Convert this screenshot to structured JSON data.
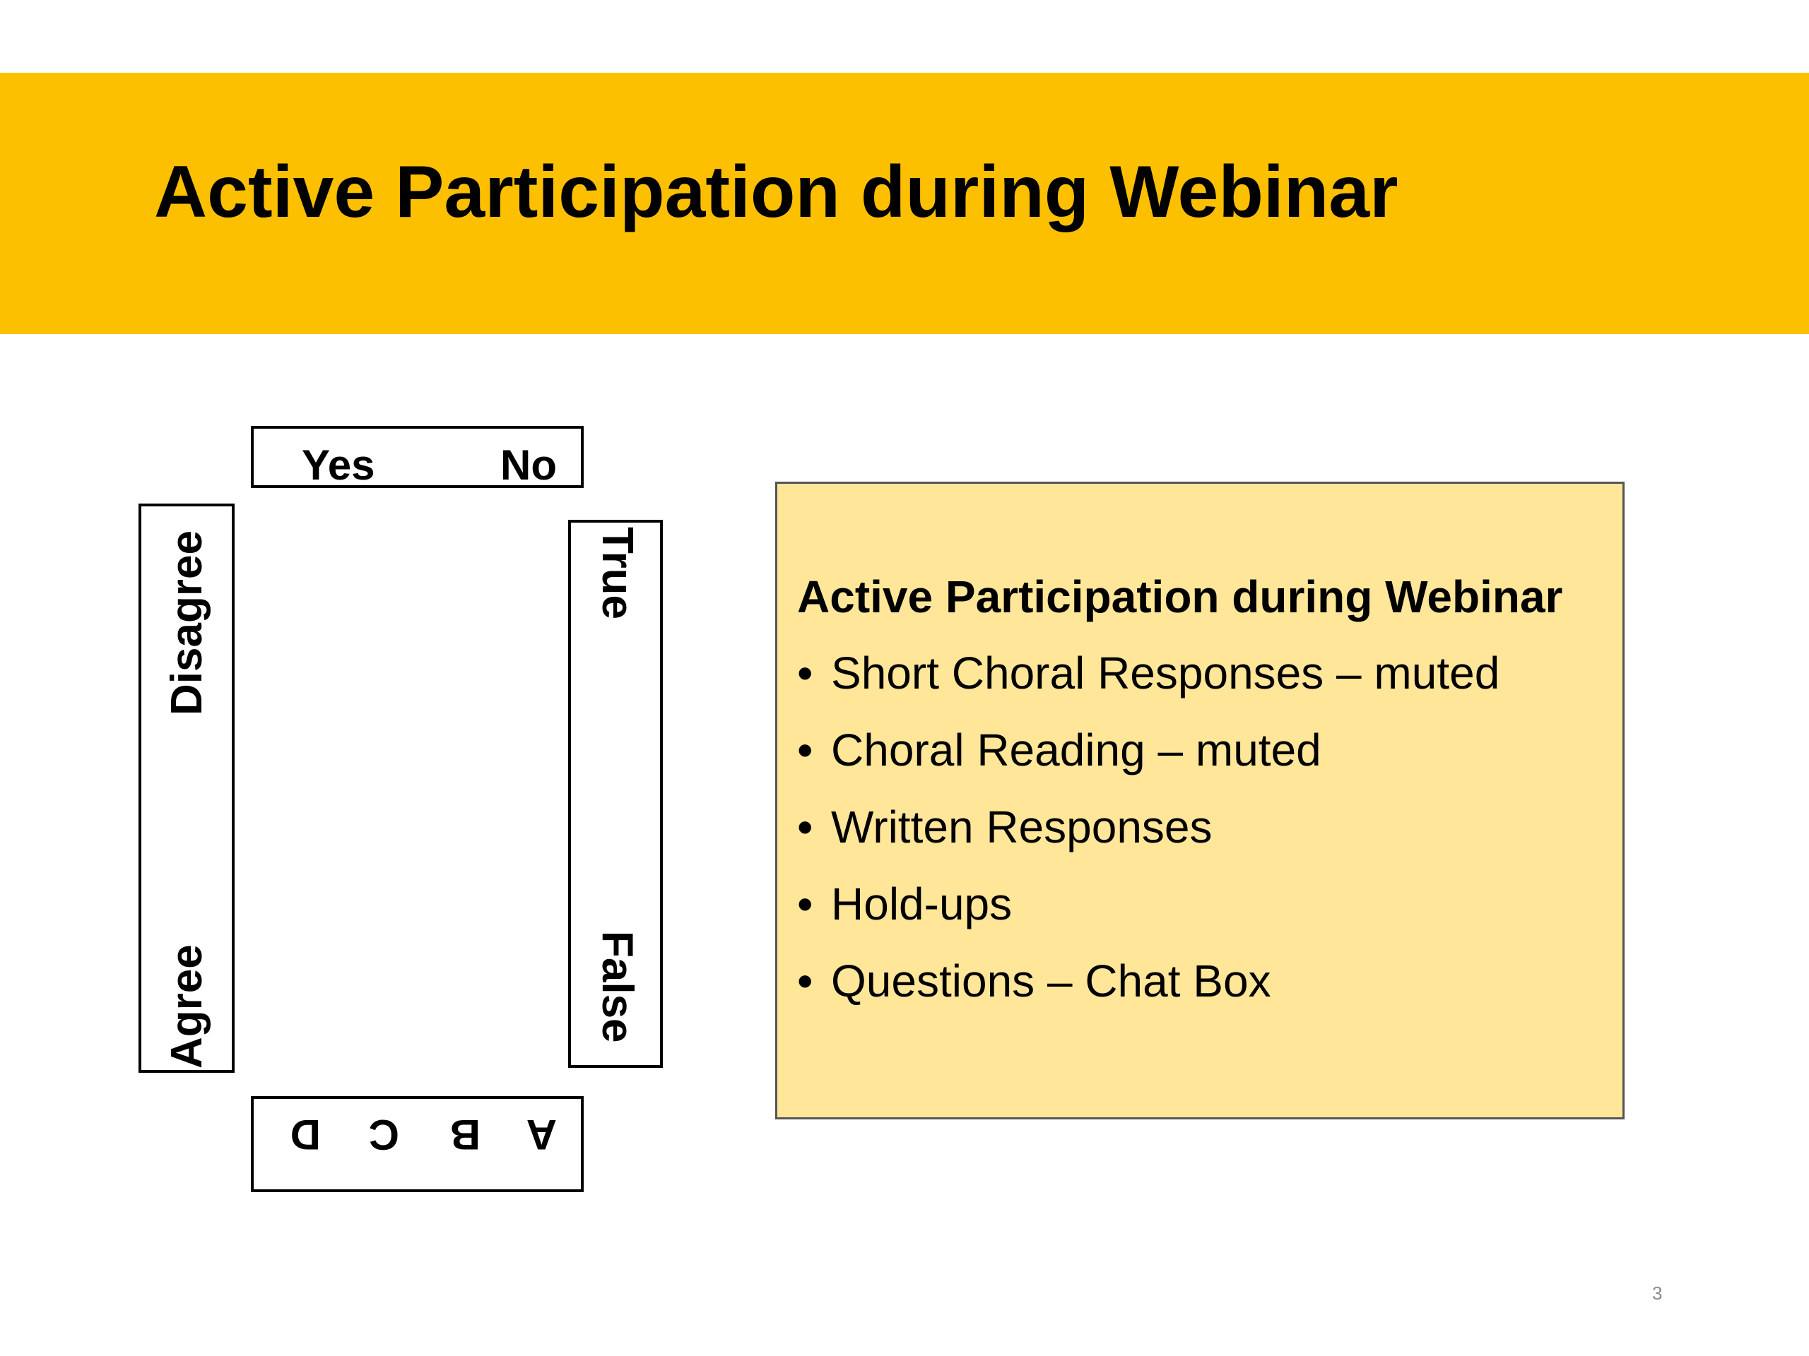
{
  "slide": {
    "title": "Active Participation during Webinar",
    "page_number": "3",
    "colors": {
      "title_band": "#FDC000",
      "info_box": "#FFE699"
    }
  },
  "cards": {
    "yes_no": {
      "left": "Yes",
      "right": "No"
    },
    "agree_disagree": {
      "first": "Agree",
      "second": "Disagree"
    },
    "true_false": {
      "first": "True",
      "second": "False"
    },
    "abcd": [
      "A",
      "B",
      "C",
      "D"
    ]
  },
  "info_box": {
    "heading": "Active Participation during Webinar",
    "bullet_glyph": "•",
    "items": [
      "Short Choral Responses – muted",
      "Choral Reading – muted",
      "Written Responses",
      "Hold-ups",
      "Questions – Chat Box"
    ]
  }
}
